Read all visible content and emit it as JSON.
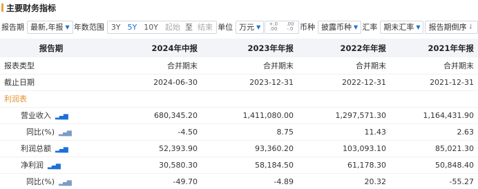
{
  "title": "主要财务指标",
  "toolbar": {
    "report_period_label": "报告期",
    "report_period_value": "最新,年报",
    "year_range_label": "年数范围",
    "year_options": [
      "3Y",
      "5Y",
      "10Y"
    ],
    "year_active": "5Y",
    "start_placeholder": "起始",
    "to_label": "至",
    "end_placeholder": "结束",
    "unit_label": "单位",
    "unit_value": "万元",
    "decimal_inc": "+.0\n.00",
    "decimal_dec": ".00\n-.0",
    "currency_label": "币种",
    "currency_value": "披露币种",
    "fx_label": "汇率",
    "fx_value": "期末汇率",
    "sort_label": "报告期倒序"
  },
  "table": {
    "header": [
      "报告期",
      "2024年中报",
      "2023年年报",
      "2022年年报",
      "2021年年报"
    ],
    "rows": [
      {
        "label": "报表类型",
        "values": [
          "合并期末",
          "合并期末",
          "合并期末",
          "合并期末"
        ]
      },
      {
        "label": "截止日期",
        "values": [
          "2024-06-30",
          "2023-12-31",
          "2022-12-31",
          "2021-12-31"
        ]
      },
      {
        "label": "利润表",
        "values": [
          "",
          "",
          "",
          ""
        ]
      },
      {
        "label": "营业收入",
        "values": [
          "680,345.20",
          "1,411,080.00",
          "1,297,571.30",
          "1,164,431.90"
        ]
      },
      {
        "label": "同比(%)",
        "values": [
          "-4.50",
          "8.75",
          "11.43",
          "2.63"
        ]
      },
      {
        "label": "利润总额",
        "values": [
          "52,393.90",
          "93,360.20",
          "103,093.10",
          "85,021.30"
        ]
      },
      {
        "label": "净利润",
        "values": [
          "30,580.30",
          "58,184.50",
          "61,178.30",
          "50,848.40"
        ]
      },
      {
        "label": "同比(%)",
        "values": [
          "-49.70",
          "-4.89",
          "20.32",
          "-55.27"
        ]
      }
    ]
  },
  "colors": {
    "accent": "#1e6fd9",
    "section": "#e8902c",
    "header_bg": "#f2f4f7"
  }
}
